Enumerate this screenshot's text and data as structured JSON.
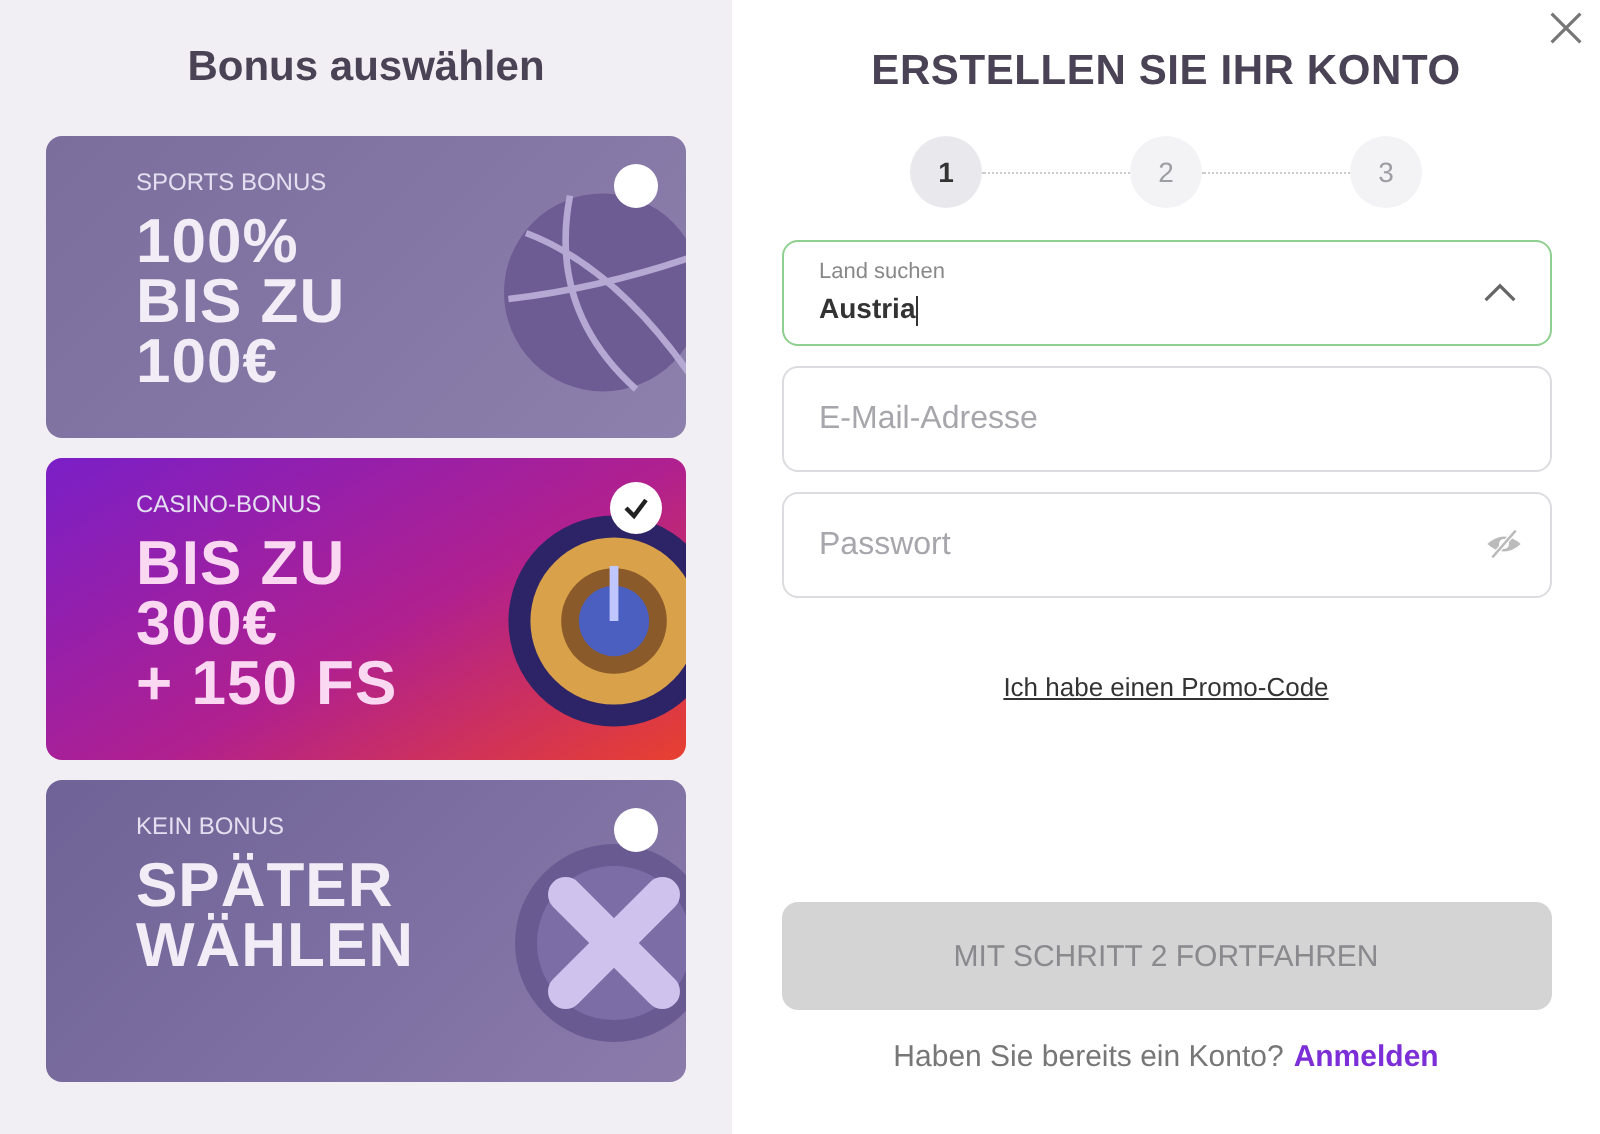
{
  "bonus_panel": {
    "title": "Bonus auswählen",
    "bonuses": [
      {
        "kind": "sports",
        "label": "SPORTS BONUS",
        "headline": [
          "100%",
          "BIS ZU",
          "100€"
        ],
        "selected": false
      },
      {
        "kind": "casino",
        "label": "CASINO-BONUS",
        "headline": [
          "BIS ZU",
          "300€",
          "+ 150 FS"
        ],
        "selected": true
      },
      {
        "kind": "none",
        "label": "KEIN BONUS",
        "headline": [
          "SPÄTER",
          "WÄHLEN"
        ],
        "selected": false
      }
    ]
  },
  "form": {
    "title": "ERSTELLEN SIE IHR KONTO",
    "steps": [
      {
        "label": "1",
        "selected": true
      },
      {
        "label": "2",
        "selected": false
      },
      {
        "label": "3",
        "selected": false
      }
    ],
    "country": {
      "label": "Land suchen",
      "value": "Austria",
      "expanded": true
    },
    "email": {
      "placeholder": "E-Mail-Adresse"
    },
    "password": {
      "placeholder": "Passwort"
    },
    "promo_link": "Ich habe einen Promo-Code",
    "submit": {
      "label": "MIT SCHRITT 2 FORTFAHREN",
      "disabled": true
    },
    "login_prompt": "Haben Sie bereits ein Konto?",
    "login_link": "Anmelden"
  }
}
